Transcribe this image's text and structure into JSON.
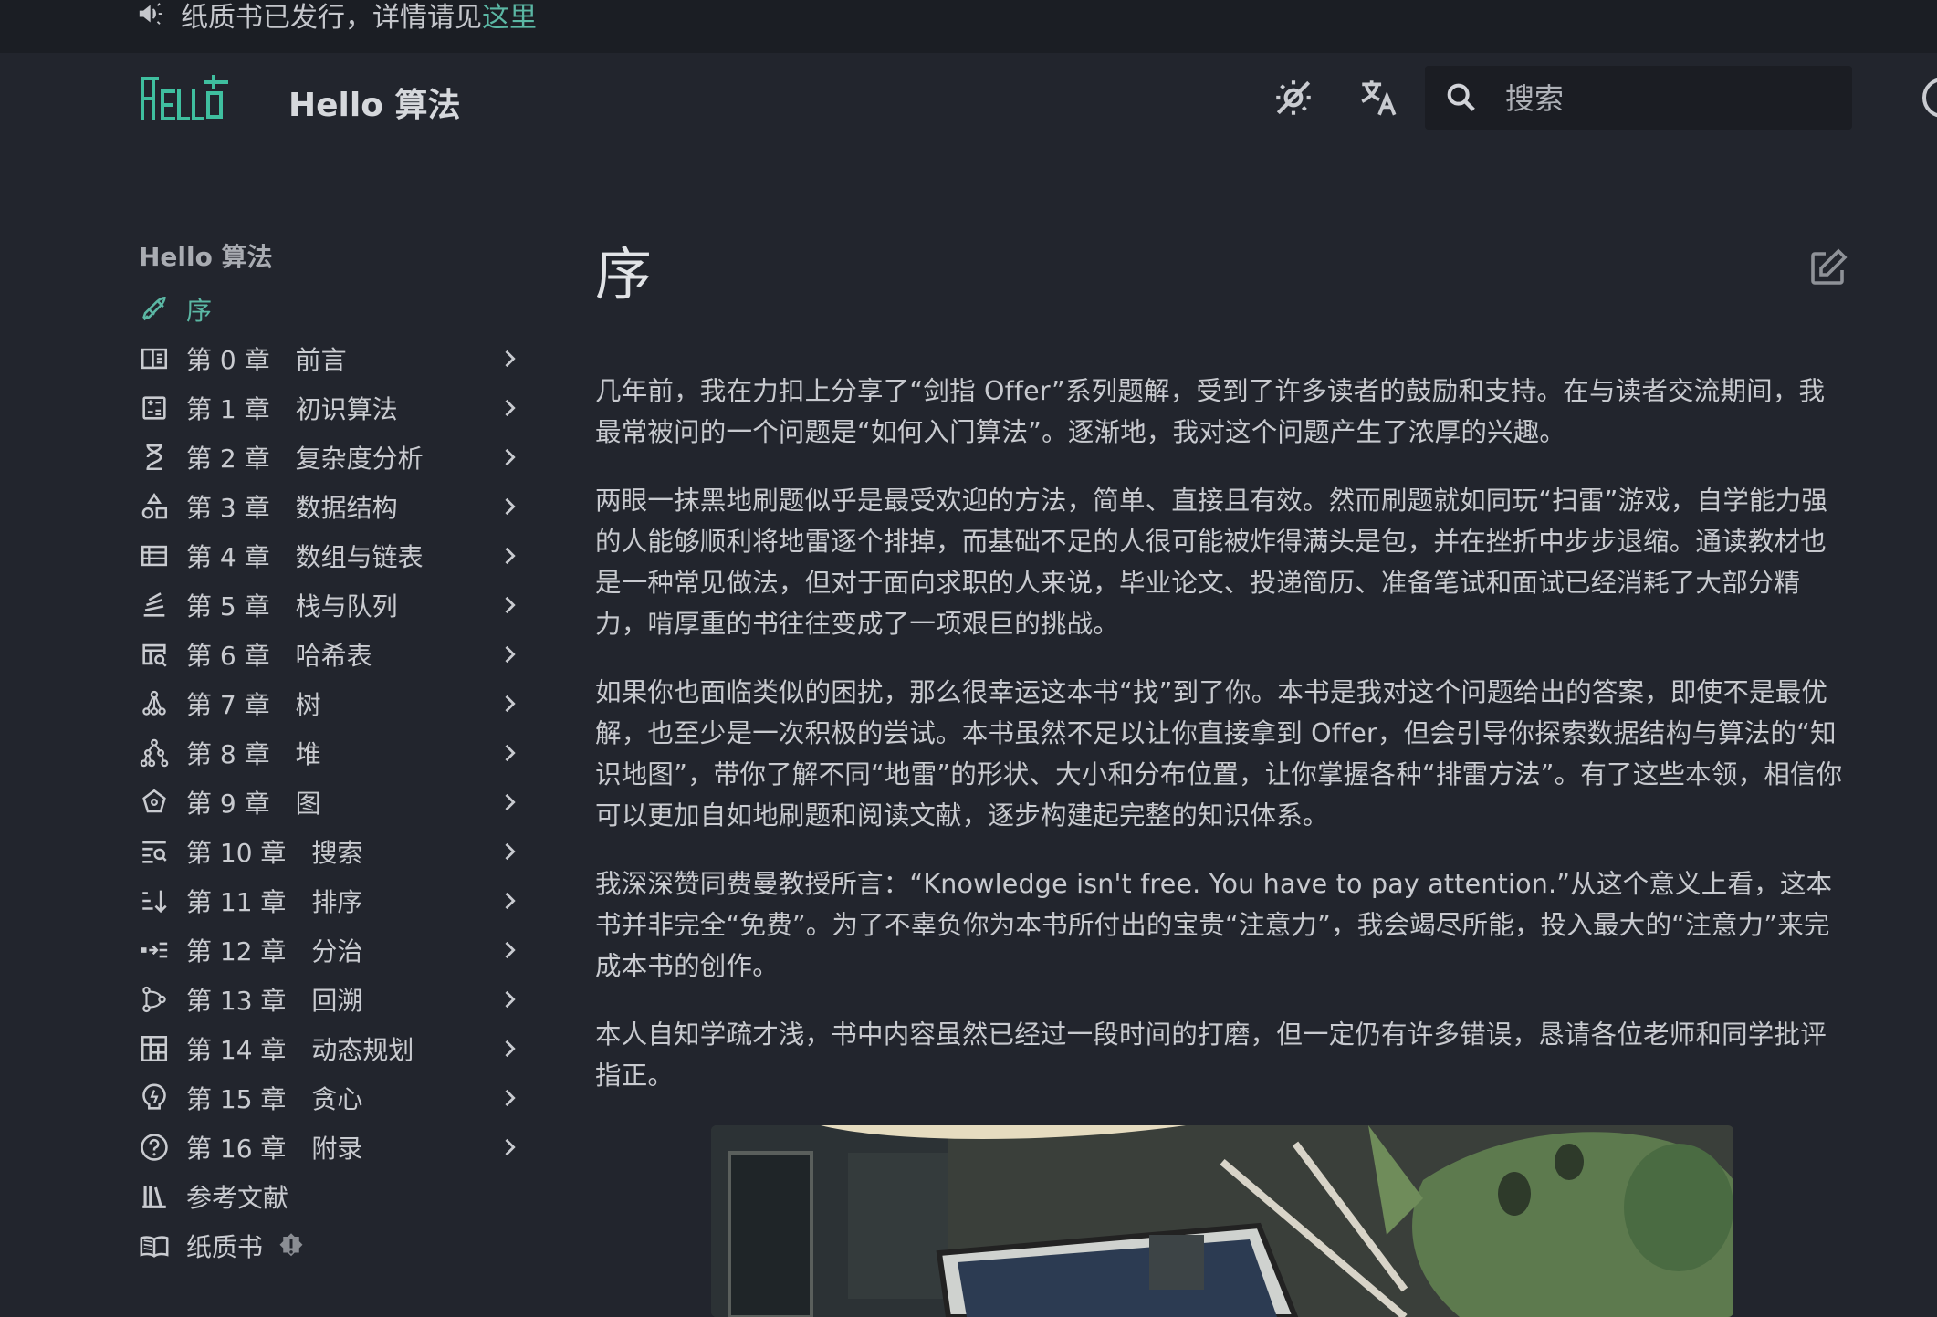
{
  "announcement": {
    "text": "纸质书已发行，详情请见",
    "link_text": "这里",
    "icon": "megaphone-icon"
  },
  "header": {
    "logo_text": "HELLO 算法",
    "site_title": "Hello 算法",
    "search_placeholder": "搜索",
    "icons": [
      "theme-toggle-icon",
      "translate-icon",
      "search-icon",
      "github-icon"
    ]
  },
  "sidebar": {
    "title": "Hello 算法",
    "items": [
      {
        "label": "序",
        "icon": "rocket-icon",
        "active": true,
        "expandable": false
      },
      {
        "label": "第 0 章　前言",
        "icon": "book-open-icon",
        "active": false,
        "expandable": true
      },
      {
        "label": "第 1 章　初识算法",
        "icon": "calculator-icon",
        "active": false,
        "expandable": true
      },
      {
        "label": "第 2 章　复杂度分析",
        "icon": "hourglass-icon",
        "active": false,
        "expandable": true
      },
      {
        "label": "第 3 章　数据结构",
        "icon": "shapes-icon",
        "active": false,
        "expandable": true
      },
      {
        "label": "第 4 章　数组与链表",
        "icon": "list-table-icon",
        "active": false,
        "expandable": true
      },
      {
        "label": "第 5 章　栈与队列",
        "icon": "stack-icon",
        "active": false,
        "expandable": true
      },
      {
        "label": "第 6 章　哈希表",
        "icon": "table-search-icon",
        "active": false,
        "expandable": true
      },
      {
        "label": "第 7 章　树",
        "icon": "tree-icon",
        "active": false,
        "expandable": true
      },
      {
        "label": "第 8 章　堆",
        "icon": "heap-icon",
        "active": false,
        "expandable": true
      },
      {
        "label": "第 9 章　图",
        "icon": "graph-icon",
        "active": false,
        "expandable": true
      },
      {
        "label": "第 10 章　搜索",
        "icon": "text-search-icon",
        "active": false,
        "expandable": true
      },
      {
        "label": "第 11 章　排序",
        "icon": "sort-icon",
        "active": false,
        "expandable": true
      },
      {
        "label": "第 12 章　分治",
        "icon": "divide-icon",
        "active": false,
        "expandable": true
      },
      {
        "label": "第 13 章　回溯",
        "icon": "backtrack-icon",
        "active": false,
        "expandable": true
      },
      {
        "label": "第 14 章　动态规划",
        "icon": "grid-table-icon",
        "active": false,
        "expandable": true
      },
      {
        "label": "第 15 章　贪心",
        "icon": "lightbulb-icon",
        "active": false,
        "expandable": true
      },
      {
        "label": "第 16 章　附录",
        "icon": "help-circle-icon",
        "active": false,
        "expandable": true
      },
      {
        "label": "参考文献",
        "icon": "bookshelf-icon",
        "active": false,
        "expandable": false
      },
      {
        "label": "纸质书",
        "icon": "book-icon",
        "active": false,
        "expandable": false,
        "badge": "new-badge-icon"
      }
    ]
  },
  "main": {
    "title": "序",
    "paragraphs": [
      "几年前，我在力扣上分享了“剑指 Offer”系列题解，受到了许多读者的鼓励和支持。在与读者交流期间，我最常被问的一个问题是“如何入门算法”。逐渐地，我对这个问题产生了浓厚的兴趣。",
      "两眼一抹黑地刷题似乎是最受欢迎的方法，简单、直接且有效。然而刷题就如同玩“扫雷”游戏，自学能力强的人能够顺利将地雷逐个排掉，而基础不足的人很可能被炸得满头是包，并在挫折中步步退缩。通读教材也是一种常见做法，但对于面向求职的人来说，毕业论文、投递简历、准备笔试和面试已经消耗了大部分精力，啃厚重的书往往变成了一项艰巨的挑战。",
      "如果你也面临类似的困扰，那么很幸运这本书“找”到了你。本书是我对这个问题给出的答案，即使不是最优解，也至少是一次积极的尝试。本书虽然不足以让你直接拿到 Offer，但会引导你探索数据结构与算法的“知识地图”，带你了解不同“地雷”的形状、大小和分布位置，让你掌握各种“排雷方法”。有了这些本领，相信你可以更加自如地刷题和阅读文献，逐步构建起完整的知识体系。",
      "我深深赞同费曼教授所言：“Knowledge isn't free. You have to pay attention.”从这个意义上看，这本书并非完全“免费”。为了不辜负你为本书所付出的宝贵“注意力”，我会竭尽所能，投入最大的“注意力”来完成本书的创作。",
      "本人自知学疏才浅，书中内容虽然已经过一段时间的打磨，但一定仍有许多错误，恳请各位老师和同学批评指正。"
    ]
  },
  "colors": {
    "background": "#22252d",
    "announcement_bg": "#1b1e24",
    "accent": "#5bb7a4",
    "text": "#c8cacf",
    "search_bg": "#1b1d23"
  }
}
